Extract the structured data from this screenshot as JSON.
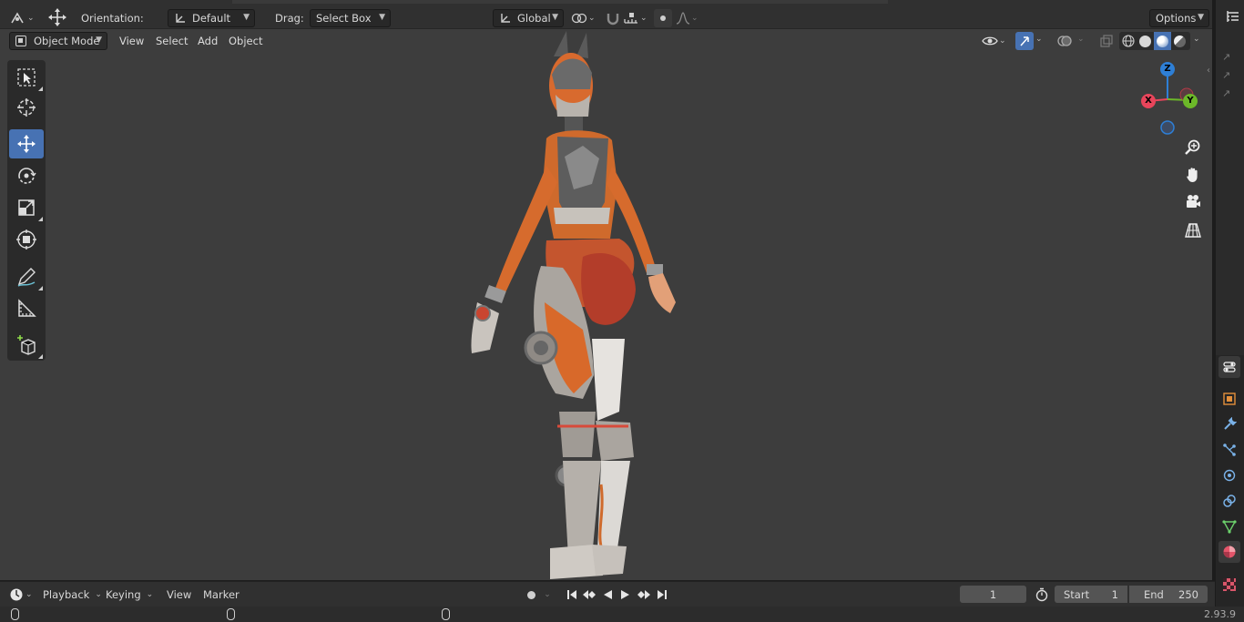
{
  "header": {
    "orientation_label": "Orientation:",
    "orientation_value": "Default",
    "drag_label": "Drag:",
    "drag_value": "Select Box",
    "transform_space": "Global",
    "options_label": "Options"
  },
  "viewport_header": {
    "mode": "Object Mode",
    "menus": [
      "View",
      "Select",
      "Add",
      "Object"
    ]
  },
  "gizmo": {
    "z": "Z",
    "x": "X",
    "y": "Y"
  },
  "timeline": {
    "menus": [
      "Playback",
      "Keying",
      "View",
      "Marker"
    ],
    "current_frame": "1",
    "start_label": "Start",
    "start_value": "1",
    "end_label": "End",
    "end_value": "250"
  },
  "status": {
    "version": "2.93.9"
  },
  "colors": {
    "accent": "#4772b3",
    "viewport_bg": "#3d3d3d",
    "axis_x": "#e8455b",
    "axis_y": "#6cb829",
    "axis_z": "#2e7fd6"
  }
}
